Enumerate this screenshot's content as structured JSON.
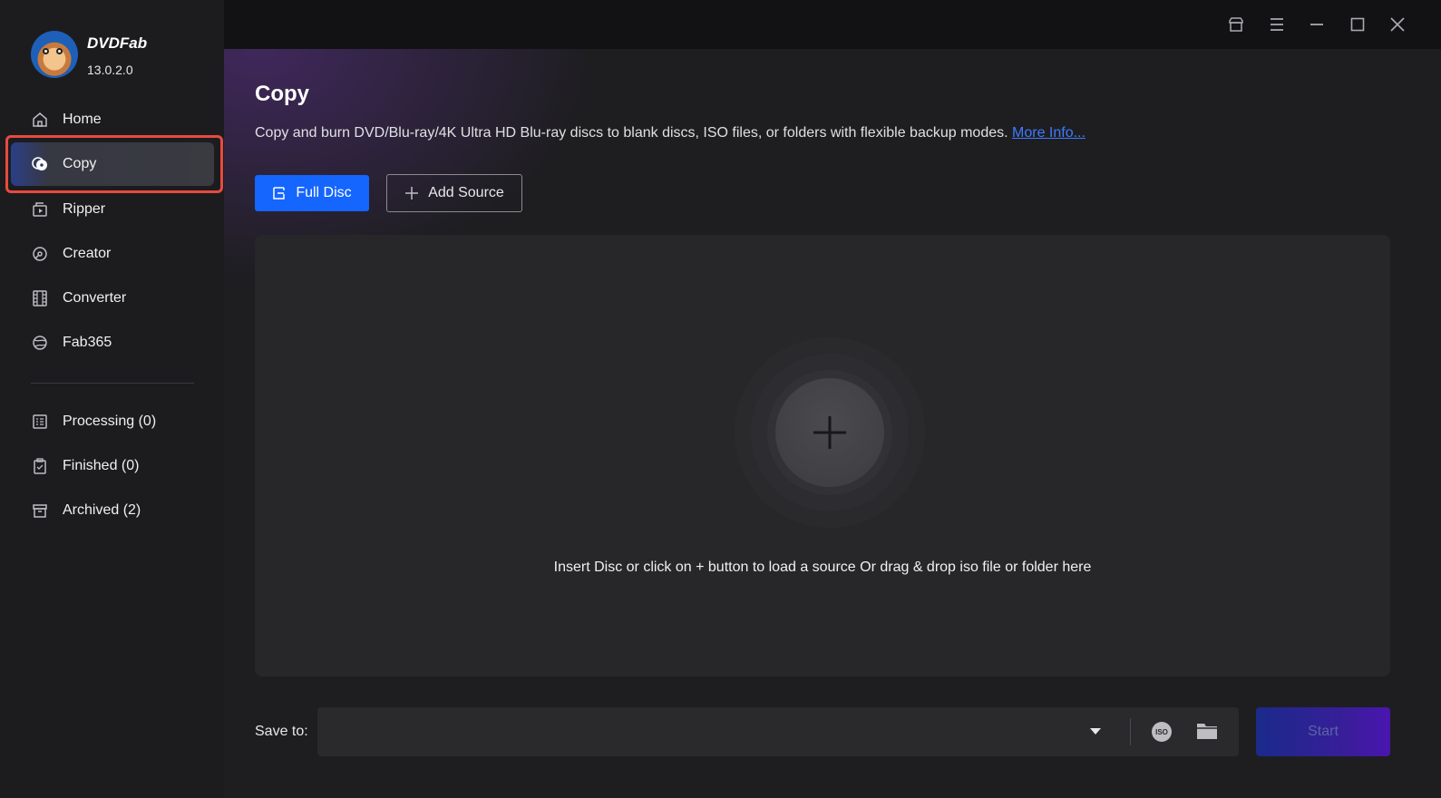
{
  "app": {
    "name": "DVDFab",
    "version": "13.0.2.0"
  },
  "sidebar": {
    "items": [
      {
        "id": "home",
        "label": "Home",
        "icon": "home-icon"
      },
      {
        "id": "copy",
        "label": "Copy",
        "icon": "disc-copy-icon",
        "active": true
      },
      {
        "id": "ripper",
        "label": "Ripper",
        "icon": "ripper-icon"
      },
      {
        "id": "creator",
        "label": "Creator",
        "icon": "creator-icon"
      },
      {
        "id": "converter",
        "label": "Converter",
        "icon": "film-icon"
      },
      {
        "id": "fab365",
        "label": "Fab365",
        "icon": "fab365-icon"
      }
    ],
    "queue": [
      {
        "id": "processing",
        "label": "Processing (0)",
        "icon": "processing-icon"
      },
      {
        "id": "finished",
        "label": "Finished (0)",
        "icon": "clipboard-icon"
      },
      {
        "id": "archived",
        "label": "Archived (2)",
        "icon": "archive-icon"
      }
    ]
  },
  "topbar": {
    "icons": [
      "shop-icon",
      "menu-icon",
      "minimize-icon",
      "maximize-icon",
      "close-icon"
    ]
  },
  "main": {
    "title": "Copy",
    "description": "Copy and burn DVD/Blu-ray/4K Ultra HD Blu-ray discs to blank discs, ISO files, or folders with flexible backup modes.",
    "more_info": "More Info...",
    "mode_button": "Full Disc",
    "add_source_button": "Add Source",
    "drop_hint": "Insert Disc or click on + button to load a source Or drag & drop iso file or folder here"
  },
  "footer": {
    "save_to_label": "Save to:",
    "save_to_value": "",
    "iso_label": "ISO",
    "start_button": "Start"
  },
  "colors": {
    "accent": "#1565ff",
    "highlight_border": "#e74a3f",
    "link": "#3d7bff"
  }
}
